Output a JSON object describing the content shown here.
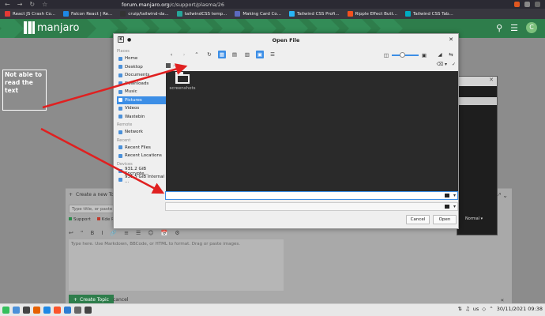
{
  "browser": {
    "url_host": "forum.manjaro.org",
    "url_path": "/c/support/plasma/26",
    "bookmarks": [
      {
        "label": "React JS Crash Co...",
        "color": "#e53935"
      },
      {
        "label": "Falcon React | Re...",
        "color": "#1e88e5"
      },
      {
        "label": "cruip/tailwind-da...",
        "color": "#333333"
      },
      {
        "label": "tailwindCSS temp...",
        "color": "#26a69a"
      },
      {
        "label": "Making Card Co...",
        "color": "#5c6bc0"
      },
      {
        "label": "Tailwind CSS Profi...",
        "color": "#29b6f6"
      },
      {
        "label": "Ripple Effect Butt...",
        "color": "#f4511e"
      },
      {
        "label": "Tailwind CSS Tab...",
        "color": "#00acc1"
      }
    ]
  },
  "site": {
    "brand": "manjaro",
    "avatar_letter": "C",
    "accent": "#2e7d4b"
  },
  "composer": {
    "create_label": "Create a new Topic",
    "title_placeholder": "Type title, or paste a link here",
    "tag_support": "Support",
    "tag_kde": "Kde Pl...",
    "editor_placeholder": "Type here. Use Markdown, BBCode, or HTML to format. Drag or paste images.",
    "create_button": "Create Topic",
    "cancel": "cancel",
    "toolbar_icons": [
      "↩",
      "“",
      "B",
      "I",
      "🔗",
      "≡",
      "☰",
      "☺",
      "📅",
      "⚙"
    ]
  },
  "bg_window": {
    "dropdown": "Normal"
  },
  "dialog": {
    "title": "Open File",
    "places_header": "Places",
    "places": [
      "Home",
      "Desktop",
      "Documents",
      "Downloads",
      "Music",
      "Pictures",
      "Videos",
      "Wastebin"
    ],
    "selected_place": "Pictures",
    "remote_header": "Remote",
    "remote": [
      "Network"
    ],
    "recent_header": "Recent",
    "recent": [
      "Recent Files",
      "Recent Locations"
    ],
    "devices_header": "Devices",
    "devices": [
      "931.2 GiB Encrypte...",
      "931.5 GiB Internal ..."
    ],
    "folder_name": "screenshots",
    "cancel": "Cancel",
    "open": "Open"
  },
  "annotation": {
    "note": "Not able to read the text",
    "color": "#e02020"
  },
  "taskbar": {
    "lang": "us",
    "datetime": "30/11/2021 09:38"
  }
}
